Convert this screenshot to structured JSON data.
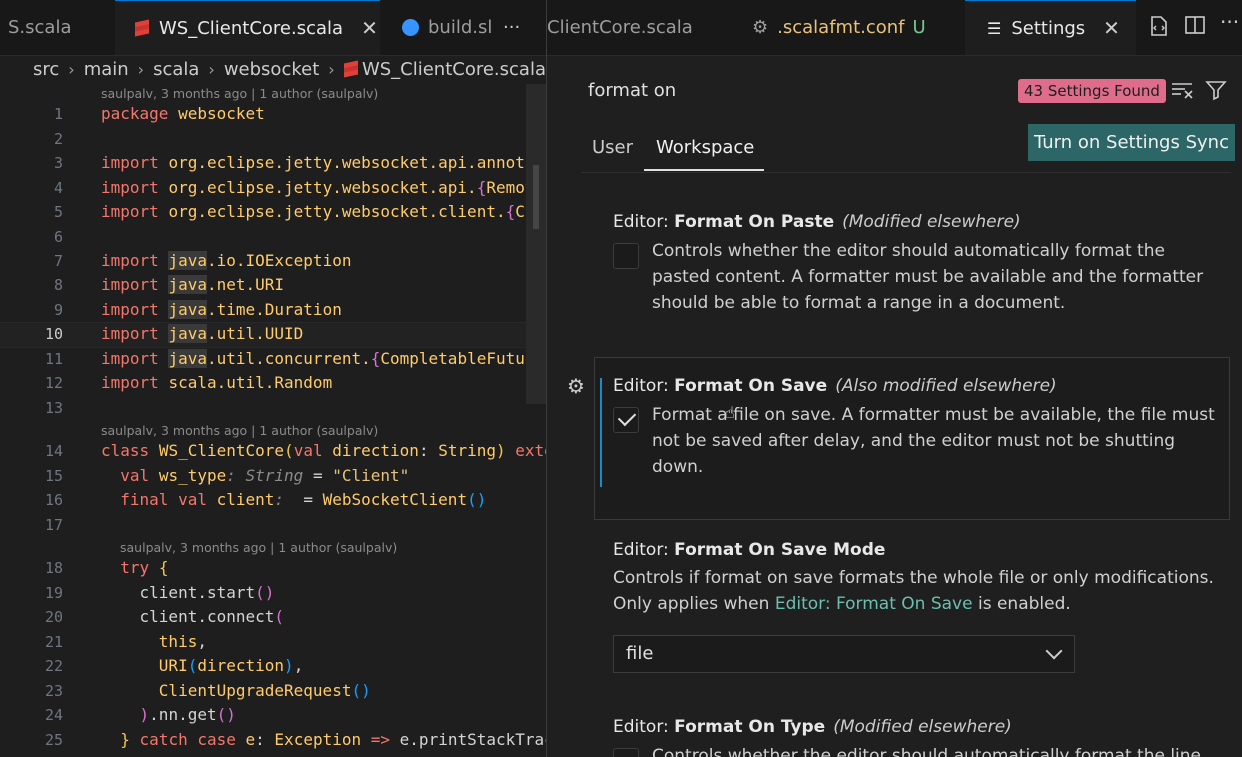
{
  "left": {
    "tabs": [
      {
        "label": "S.scala"
      },
      {
        "label": "WS_ClientCore.scala",
        "close": "✕"
      },
      {
        "label": "build.sl"
      }
    ],
    "more": "···",
    "breadcrumb": [
      "src",
      "main",
      "scala",
      "websocket",
      "WS_ClientCore.scala"
    ],
    "blame": [
      "saulpalv, 3 months ago | 1 author (saulpalv)",
      "saulpalv, 3 months ago | 1 author (saulpalv)",
      "saulpalv, 3 months ago | 1 author (saulpalv)"
    ],
    "line_numbers": [
      "1",
      "2",
      "3",
      "4",
      "5",
      "6",
      "7",
      "8",
      "9",
      "10",
      "11",
      "12",
      "13",
      "14",
      "15",
      "16",
      "17",
      "18",
      "19",
      "20",
      "21",
      "22",
      "23",
      "24",
      "25"
    ]
  },
  "right": {
    "tabs": [
      {
        "label": "ClientCore.scala"
      },
      {
        "label": ".scalafmt.conf",
        "badge": "U"
      },
      {
        "label": "Settings",
        "close": "✕"
      }
    ],
    "more": "···",
    "search": {
      "value": "format on",
      "found": "43 Settings Found"
    },
    "scope_tabs": [
      "User",
      "Workspace"
    ],
    "sync_button": "Turn on Settings Sync",
    "settings": [
      {
        "prefix": "Editor: ",
        "name": "Format On Paste",
        "note": "(Modified elsewhere)",
        "desc": "Controls whether the editor should automatically format the pasted content. A formatter must be available and the formatter should be able to format a range in a document.",
        "checked": false
      },
      {
        "prefix": "Editor: ",
        "name": "Format On Save",
        "note": "(Also modified elsewhere)",
        "desc": "Format a file on save. A formatter must be available, the file must not be saved after delay, and the editor must not be shutting down.",
        "checked": true
      },
      {
        "prefix": "Editor: ",
        "name": "Format On Save Mode",
        "desc_a": "Controls if format on save formats the whole file or only modifications. Only applies when ",
        "desc_link": "Editor: Format On Save",
        "desc_b": " is enabled.",
        "value": "file"
      },
      {
        "prefix": "Editor: ",
        "name": "Format On Type",
        "note": "(Modified elsewhere)",
        "desc": "Controls whether the editor should automatically format the line"
      }
    ]
  },
  "colors": {
    "accent": "#0078d4",
    "badge": "#e06c8c",
    "sync": "#2d6667",
    "focus": "#1c8cc4"
  }
}
